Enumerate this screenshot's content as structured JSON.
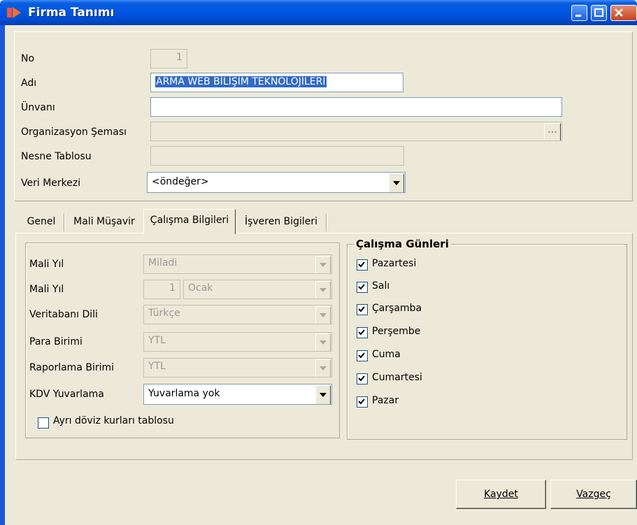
{
  "window": {
    "title": "Firma Tanımı"
  },
  "form": {
    "no_label": "No",
    "no_value": "1",
    "adi_label": "Adı",
    "adi_value": "ARMA WEB BİLİŞİM TEKNOLOJİLERİ",
    "unvani_label": "Ünvanı",
    "unvani_value": "",
    "org_label": "Organizasyon Şeması",
    "org_value": "",
    "org_button": "...",
    "nesne_label": "Nesne Tablosu",
    "nesne_value": "",
    "veri_label": "Veri Merkezi",
    "veri_value": "<öndeğer>"
  },
  "tabs": [
    {
      "label": "Genel"
    },
    {
      "label": "Mali Müşavir"
    },
    {
      "label": "Çalışma Bilgileri"
    },
    {
      "label": "İşveren Bigileri"
    }
  ],
  "active_tab": "Çalışma Bilgileri",
  "calisma": {
    "mali_yil_label": "Mali Yıl",
    "mali_yil_value": "Miladi",
    "mali_yil2_label": "Mali Yıl",
    "mali_yil2_number": "1",
    "mali_yil2_month": "Ocak",
    "vt_dili_label": "Veritabanı Dili",
    "vt_dili_value": "Türkçe",
    "para_label": "Para Birimi",
    "para_value": "YTL",
    "rapor_label": "Raporlama Birimi",
    "rapor_value": "YTL",
    "kdv_label": "KDV Yuvarlama",
    "kdv_value": "Yuvarlama yok",
    "ayri_doviz_label": "Ayrı döviz kurları tablosu",
    "ayri_doviz_checked": false
  },
  "calisma_gunleri": {
    "title": "Çalışma Günleri",
    "days": [
      {
        "label": "Pazartesi",
        "checked": true
      },
      {
        "label": "Salı",
        "checked": true
      },
      {
        "label": "Çarşamba",
        "checked": true
      },
      {
        "label": "Perşembe",
        "checked": true
      },
      {
        "label": "Cuma",
        "checked": true
      },
      {
        "label": "Cumartesi",
        "checked": true
      },
      {
        "label": "Pazar",
        "checked": true
      }
    ]
  },
  "buttons": {
    "save_label": "Kaydet",
    "cancel_label": "Vazgeç"
  }
}
